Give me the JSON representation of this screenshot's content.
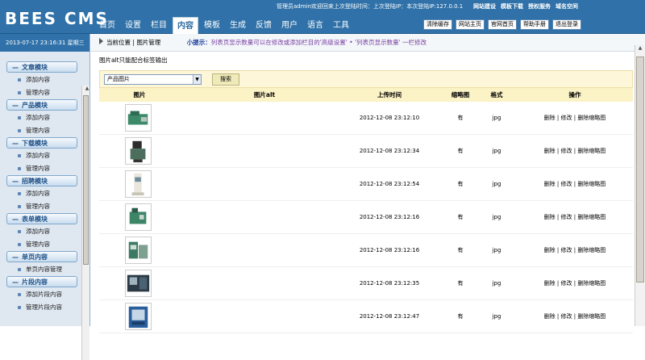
{
  "app": {
    "logo": "BEES CMS"
  },
  "header": {
    "admin_info": "管理员admin欢迎回来上次登陆时间：上次登陆IP：本次登陆IP:127.0.0.1",
    "top_links": [
      "网站建设",
      "模板下载",
      "授权服务",
      "域名空间"
    ],
    "nav": [
      "首页",
      "设置",
      "栏目",
      "内容",
      "模板",
      "生成",
      "反馈",
      "用户",
      "语言",
      "工具"
    ],
    "active_nav": "内容",
    "buttons": [
      "清除缓存",
      "网站主页",
      "官网首页",
      "帮助手册",
      "退出登录"
    ]
  },
  "sidebar": {
    "datetime": "2013-07-17 23:16:31 星期三",
    "sections": [
      {
        "title": "文章模块",
        "items": [
          "添加内容",
          "管理内容"
        ]
      },
      {
        "title": "产品模块",
        "items": [
          "添加内容",
          "管理内容"
        ]
      },
      {
        "title": "下载模块",
        "items": [
          "添加内容",
          "管理内容"
        ]
      },
      {
        "title": "招聘模块",
        "items": [
          "添加内容",
          "管理内容"
        ]
      },
      {
        "title": "表单模块",
        "items": [
          "添加内容",
          "管理内容"
        ]
      },
      {
        "title": "单页内容",
        "items": [
          "单页内容管理"
        ]
      },
      {
        "title": "片段内容",
        "items": [
          "添加片段内容",
          "管理片段内容"
        ]
      }
    ]
  },
  "main": {
    "crumb_label": "当前位置",
    "crumb_page": "图片管理",
    "tip_label": "小提示：",
    "tip_text1": "列表页显示数量可以在修改或添加栏目的",
    "tip_text2": "'高级设置'",
    "tip_text3": "'列表页显示数量'",
    "tip_text4": "一栏修改",
    "description": "图片alt只能配合标签输出",
    "select_value": "产品图片",
    "search_label": "搜索",
    "columns": [
      "图片",
      "图片alt",
      "上传时间",
      "缩略图",
      "格式",
      "操作"
    ],
    "rows": [
      {
        "alt": "",
        "time": "2012-12-08 23:12:10",
        "thumb": "有",
        "format": "jpg",
        "ops": [
          "删除",
          "修改",
          "删除缩略图"
        ]
      },
      {
        "alt": "",
        "time": "2012-12-08 23:12:34",
        "thumb": "有",
        "format": "jpg",
        "ops": [
          "删除",
          "修改",
          "删除缩略图"
        ]
      },
      {
        "alt": "",
        "time": "2012-12-08 23:12:54",
        "thumb": "有",
        "format": "jpg",
        "ops": [
          "删除",
          "修改",
          "删除缩略图"
        ]
      },
      {
        "alt": "",
        "time": "2012-12-08 23:12:16",
        "thumb": "有",
        "format": "jpg",
        "ops": [
          "删除",
          "修改",
          "删除缩略图"
        ]
      },
      {
        "alt": "",
        "time": "2012-12-08 23:12:16",
        "thumb": "有",
        "format": "jpg",
        "ops": [
          "删除",
          "修改",
          "删除缩略图"
        ]
      },
      {
        "alt": "",
        "time": "2012-12-08 23:12:35",
        "thumb": "有",
        "format": "jpg",
        "ops": [
          "删除",
          "修改",
          "删除缩略图"
        ]
      },
      {
        "alt": "",
        "time": "2012-12-08 23:12:47",
        "thumb": "有",
        "format": "jpg",
        "ops": [
          "删除",
          "修改",
          "删除缩略图"
        ]
      }
    ]
  },
  "colors": {
    "header_bg": "#2f71a8",
    "sidebar_bg": "#dfe8f1",
    "table_header_bg": "#fbf2c5",
    "tip_label": "#1a3c9a",
    "tip_text": "#7a3fa0"
  }
}
